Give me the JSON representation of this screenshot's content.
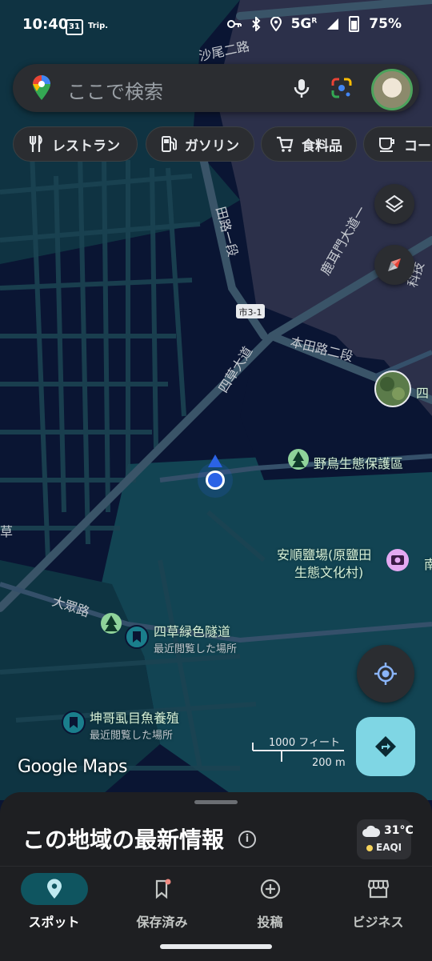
{
  "status_bar": {
    "time": "10:40",
    "calendar_day": "31",
    "app_note": "Trip.",
    "network": "5G",
    "network_sub": "R",
    "battery": "75%"
  },
  "search": {
    "placeholder": "ここで検索"
  },
  "chips": [
    {
      "label": "レストラン",
      "icon": "restaurant-icon"
    },
    {
      "label": "ガソリン",
      "icon": "gas-station-icon"
    },
    {
      "label": "食料品",
      "icon": "grocery-cart-icon"
    },
    {
      "label": "コーヒー",
      "icon": "coffee-icon"
    }
  ],
  "map": {
    "road_labels": [
      "田路一段",
      "沙尾二路",
      "鹿耳門大道一",
      "科技",
      "本田路二段",
      "四草大道",
      "大眾路",
      "草"
    ],
    "route_shield": "市3-1",
    "places": [
      {
        "name": "野鳥生態保護區",
        "sub": "",
        "icon": "park-icon"
      },
      {
        "name": "安順鹽場(原鹽田",
        "sub": "生態文化村)",
        "icon": "camera-icon"
      },
      {
        "name": "四草緑色隧道",
        "sub": "最近閲覧した場所",
        "icon": "bookmark-icon"
      },
      {
        "name": "坤哥虱目魚養殖",
        "sub": "最近閲覧した場所",
        "icon": "bookmark-icon"
      }
    ],
    "edge_labels": [
      "四",
      "南"
    ],
    "scale": {
      "imperial": "1000 フィート",
      "metric": "200 m"
    },
    "brand": "Google Maps"
  },
  "sheet": {
    "title": "この地域の最新情報",
    "weather": {
      "temp": "31°C",
      "aqi_label": "EAQI"
    }
  },
  "nav": [
    {
      "label": "スポット",
      "icon": "place-pin-icon",
      "active": true
    },
    {
      "label": "保存済み",
      "icon": "bookmark-outline-icon",
      "active": false
    },
    {
      "label": "投稿",
      "icon": "add-circle-icon",
      "active": false
    },
    {
      "label": "ビジネス",
      "icon": "storefront-icon",
      "active": false
    }
  ],
  "colors": {
    "map_background": "#0a1533",
    "land_teal": "#113e4a",
    "road": "#3a5468",
    "accent_blue": "#2b63e6",
    "directions_button": "#7fd6e4",
    "active_nav": "#0f5560"
  }
}
